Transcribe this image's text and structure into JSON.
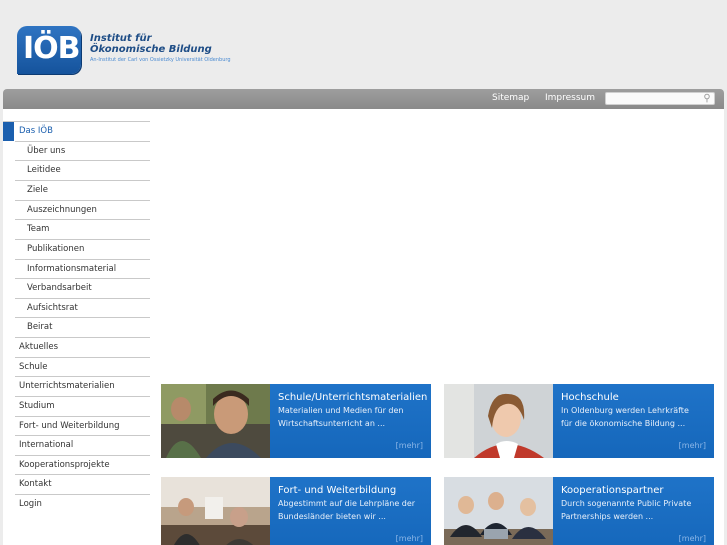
{
  "logo": {
    "mark": "IÖB",
    "line1": "Institut für",
    "line2": "Ökonomische Bildung",
    "line3": "An-Institut der Carl von Ossietzky Universität Oldenburg"
  },
  "topnav": {
    "sitemap": "Sitemap",
    "impressum": "Impressum",
    "search_placeholder": ""
  },
  "sidebar": {
    "items": [
      {
        "label": "Das IÖB"
      },
      {
        "label": "Über uns"
      },
      {
        "label": "Leitidee"
      },
      {
        "label": "Ziele"
      },
      {
        "label": "Auszeichnungen"
      },
      {
        "label": "Team"
      },
      {
        "label": "Publikationen"
      },
      {
        "label": "Informationsmaterial"
      },
      {
        "label": "Verbandsarbeit"
      },
      {
        "label": "Aufsichtsrat"
      },
      {
        "label": "Beirat"
      },
      {
        "label": "Aktuelles"
      },
      {
        "label": "Schule"
      },
      {
        "label": "Unterrichtsmaterialien"
      },
      {
        "label": "Studium"
      },
      {
        "label": "Fort- und Weiterbildung"
      },
      {
        "label": "International"
      },
      {
        "label": "Kooperationsprojekte"
      },
      {
        "label": "Kontakt"
      },
      {
        "label": "Login"
      }
    ]
  },
  "teasers": [
    {
      "title": "Schule/Unterrichtsmaterialien",
      "line1": "Materialien und Medien für den",
      "line2": "Wirtschaftsunterricht an ...",
      "more": "[mehr]"
    },
    {
      "title": "Hochschule",
      "line1": "In Oldenburg werden Lehrkräfte",
      "line2": "für die ökonomische Bildung ...",
      "more": "[mehr]"
    },
    {
      "title": "Fort- und Weiterbildung",
      "line1": "Abgestimmt auf die Lehrpläne der",
      "line2": "Bundesländer bieten wir ...",
      "more": "[mehr]"
    },
    {
      "title": "Kooperationspartner",
      "line1": "Durch sogenannte Public Private",
      "line2": "Partnerships werden ...",
      "more": "[mehr]"
    }
  ],
  "colors": {
    "accent": "#1b5fae",
    "teaser_box": "#1a6dc2",
    "topbar": "#949494"
  }
}
